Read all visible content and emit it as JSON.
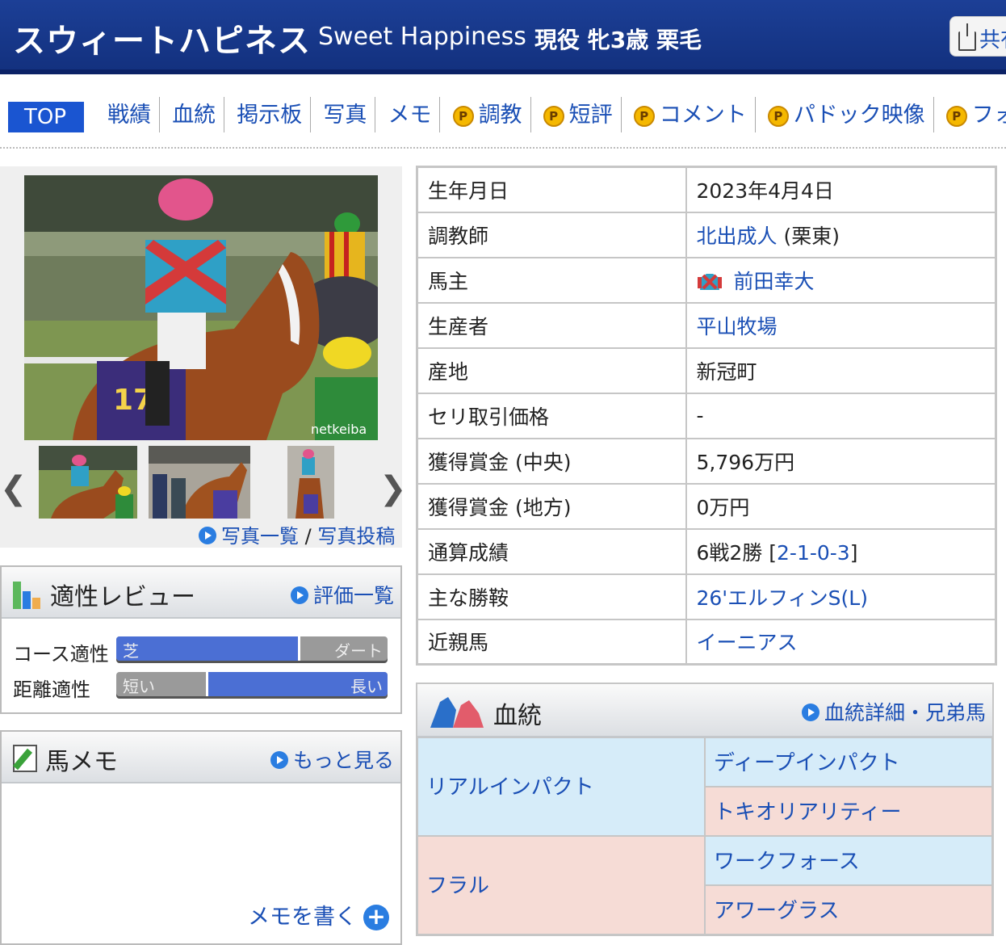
{
  "header": {
    "name_ja": "スウィートハピネス",
    "name_en": "Sweet Happiness",
    "status": "現役 牝3歳 栗毛",
    "share_label": "共有"
  },
  "tabs": [
    {
      "label": "TOP",
      "premium": false
    },
    {
      "label": "戦績",
      "premium": false
    },
    {
      "label": "血統",
      "premium": false
    },
    {
      "label": "掲示板",
      "premium": false
    },
    {
      "label": "写真",
      "premium": false
    },
    {
      "label": "メモ",
      "premium": false
    },
    {
      "label": "調教",
      "premium": true
    },
    {
      "label": "短評",
      "premium": true
    },
    {
      "label": "コメント",
      "premium": true
    },
    {
      "label": "パドック映像",
      "premium": true
    },
    {
      "label": "フォトパ",
      "premium": true
    }
  ],
  "photos": {
    "watermark": "netkeiba",
    "list_link": "写真一覧",
    "separator": "/",
    "post_link": "写真投稿"
  },
  "review": {
    "title": "適性レビュー",
    "more": "評価一覧",
    "course_label": "コース適性",
    "course_left": "芝",
    "course_right": "ダート",
    "course_turf_fraction": 0.67,
    "distance_label": "距離適性",
    "distance_left": "短い",
    "distance_right": "長い",
    "distance_long_fraction": 0.67
  },
  "memo": {
    "title": "馬メモ",
    "more": "もっと見る",
    "write": "メモを書く"
  },
  "profile": [
    {
      "key": "生年月日",
      "value": "2023年4月4日",
      "link": false
    },
    {
      "key": "調教師",
      "value": "北出成人",
      "suffix": " (栗東)",
      "link": true
    },
    {
      "key": "馬主",
      "value": "前田幸大",
      "link": true,
      "silks": true
    },
    {
      "key": "生産者",
      "value": "平山牧場",
      "link": true
    },
    {
      "key": "産地",
      "value": "新冠町",
      "link": false
    },
    {
      "key": "セリ取引価格",
      "value": "-",
      "link": false
    },
    {
      "key": "獲得賞金 (中央)",
      "value": "5,796万円",
      "link": false
    },
    {
      "key": "獲得賞金 (地方)",
      "value": "0万円",
      "link": false
    },
    {
      "key": "通算成績",
      "value": "6戦2勝 [",
      "record": "2-1-0-3",
      "suffix": "]",
      "link": false
    },
    {
      "key": "主な勝鞍",
      "value": "26'エルフィンS(L)",
      "link": true
    },
    {
      "key": "近親馬",
      "value": "イーニアス",
      "link": true
    }
  ],
  "pedigree": {
    "title": "血統",
    "more": "血統詳細・兄弟馬",
    "sire": "リアルインパクト",
    "sire_sire": "ディープインパクト",
    "sire_dam": "トキオリアリティー",
    "dam": "フラル",
    "dam_sire": "ワークフォース",
    "dam_dam": "アワーグラス"
  },
  "colors": {
    "header_bg": "#1c3f96",
    "link": "#1a4fb5",
    "tab_active": "#1a55d1",
    "ped_blue": "#d6ecf9",
    "ped_pink": "#f6dcd6",
    "slider_fill": "#4b6fd4"
  }
}
